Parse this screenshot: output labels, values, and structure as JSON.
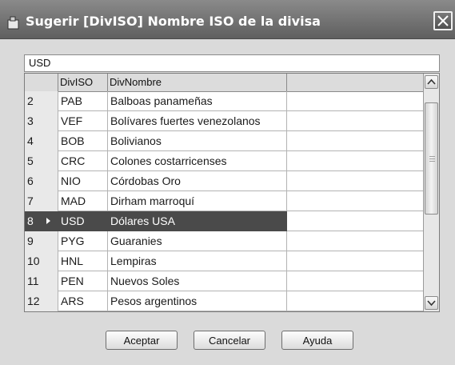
{
  "window": {
    "title": "Sugerir [DivISO] Nombre ISO de la divisa"
  },
  "search": {
    "value": "USD"
  },
  "grid": {
    "columns": [
      "",
      "DivISO",
      "DivNombre"
    ],
    "rows": [
      {
        "num": "2",
        "code": "PAB",
        "name": "Balboas panameñas"
      },
      {
        "num": "3",
        "code": "VEF",
        "name": "Bolívares fuertes venezolanos"
      },
      {
        "num": "4",
        "code": "BOB",
        "name": "Bolivianos"
      },
      {
        "num": "5",
        "code": "CRC",
        "name": "Colones costarricenses"
      },
      {
        "num": "6",
        "code": "NIO",
        "name": "Córdobas Oro"
      },
      {
        "num": "7",
        "code": "MAD",
        "name": "Dirham marroquí"
      },
      {
        "num": "8",
        "code": "USD",
        "name": "Dólares USA",
        "selected": true
      },
      {
        "num": "9",
        "code": "PYG",
        "name": "Guaranies"
      },
      {
        "num": "10",
        "code": "HNL",
        "name": "Lempiras"
      },
      {
        "num": "11",
        "code": "PEN",
        "name": "Nuevos Soles"
      },
      {
        "num": "12",
        "code": "ARS",
        "name": "Pesos argentinos"
      }
    ]
  },
  "buttons": {
    "accept": "Aceptar",
    "cancel": "Cancelar",
    "help": "Ayuda"
  },
  "icons": {
    "title": "dialog-icon",
    "close": "close-icon",
    "scroll_up": "chevron-up-icon",
    "scroll_down": "chevron-down-icon"
  },
  "colors": {
    "selected_row": "#4a4a4a",
    "titlebar": "#6b6b6b"
  }
}
